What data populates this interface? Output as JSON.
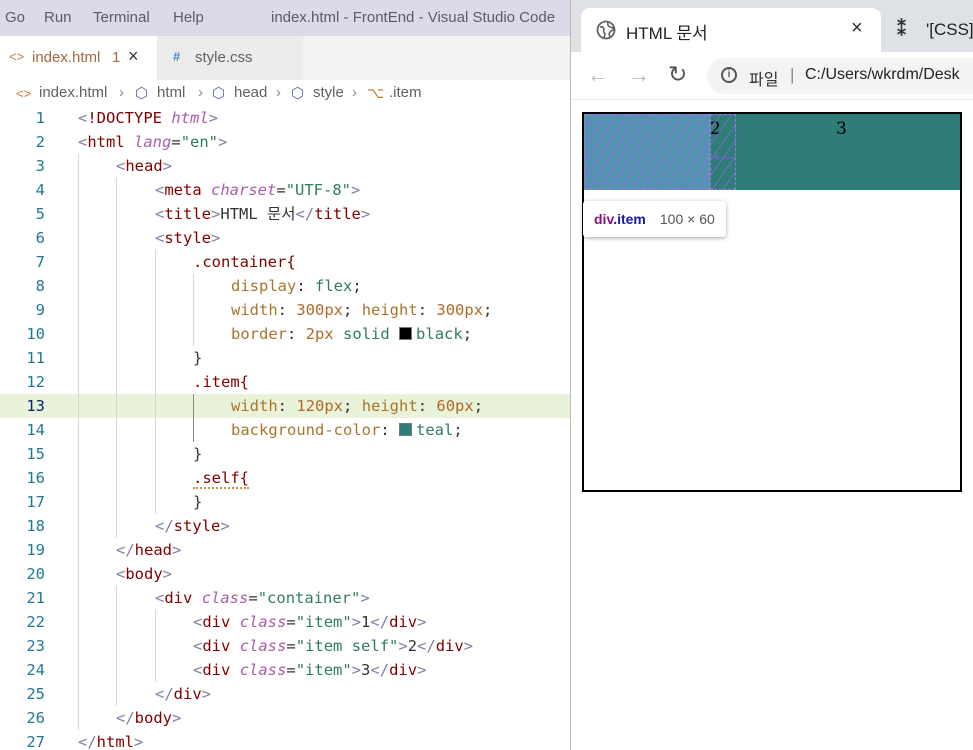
{
  "vscode": {
    "menu": [
      "Go",
      "Run",
      "Terminal",
      "Help"
    ],
    "window_title": "index.html - FrontEnd - Visual Studio Code",
    "tabs": [
      {
        "icon": "<>",
        "name": "index.html",
        "badge": "1",
        "close": "×"
      },
      {
        "icon": "#",
        "name": "style.css"
      }
    ],
    "breadcrumb": {
      "file": "index.html",
      "items": [
        "html",
        "head",
        "style",
        ".item"
      ]
    },
    "highlighted_line": 13,
    "line_numbers": [
      "1",
      "2",
      "3",
      "4",
      "5",
      "6",
      "7",
      "8",
      "9",
      "10",
      "11",
      "12",
      "13",
      "14",
      "15",
      "16",
      "17",
      "18",
      "19",
      "20",
      "21",
      "22",
      "23",
      "24",
      "25",
      "26",
      "27"
    ],
    "code": {
      "l1_kw": "!DOCTYPE",
      "l1_attr": "html",
      "tag_html": "html",
      "attr_lang": "lang",
      "val_en": "\"en\"",
      "tag_head": "head",
      "tag_meta": "meta",
      "attr_charset": "charset",
      "val_utf8": "\"UTF-8\"",
      "tag_title": "title",
      "title_text": "HTML 문서",
      "tag_style": "style",
      "sel_container": ".container{",
      "prop_display": "display",
      "val_flex": "flex",
      "prop_width": "width",
      "num_300": "300",
      "unit_px": "px",
      "prop_height": "height",
      "prop_border": "border",
      "num_2": "2",
      "val_solid": "solid",
      "val_black": "black",
      "brace_close": "}",
      "sel_item": ".item{",
      "num_120": "120",
      "num_60": "60",
      "prop_bg": "background-color",
      "val_teal": "teal",
      "sel_self": ".self{",
      "tag_body": "body",
      "tag_div": "div",
      "attr_class": "class",
      "val_container": "\"container\"",
      "val_item": "\"item\"",
      "val_item_self": "\"item self\"",
      "txt_1": "1",
      "txt_2": "2",
      "txt_3": "3"
    },
    "colors": {
      "swatch_black": "#000000",
      "swatch_teal": "#2f7c78"
    }
  },
  "browser": {
    "active_tab_title": "HTML 문서",
    "active_tab_close": "×",
    "other_tab_title": "'[CSS]",
    "address_scheme": "파일",
    "address_separator": "|",
    "address_url": "C:/Users/wkrdm/Desk",
    "page": {
      "items": [
        "",
        "2",
        "3"
      ],
      "item_color": "#2f7c78"
    },
    "inspect_tooltip": {
      "tag": "div",
      "selector": ".item",
      "dimensions": "100 × 60"
    }
  }
}
